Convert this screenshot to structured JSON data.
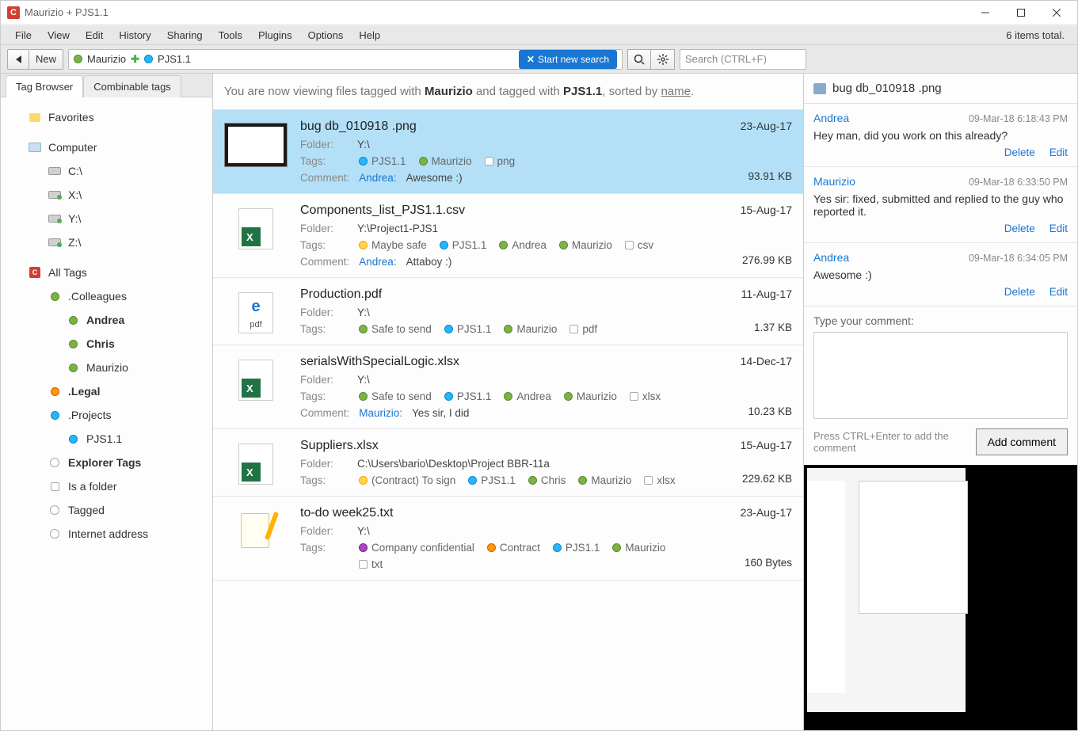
{
  "title": "Maurizio  +  PJS1.1",
  "menu": [
    "File",
    "View",
    "Edit",
    "History",
    "Sharing",
    "Tools",
    "Plugins",
    "Options",
    "Help"
  ],
  "items_total": "6 items total.",
  "toolbar": {
    "new_label": "New",
    "path_tag1": "Maurizio",
    "path_tag2": "PJS1.1",
    "start_search": "Start new search",
    "search_placeholder": "Search (CTRL+F)"
  },
  "left": {
    "tab1": "Tag Browser",
    "tab2": "Combinable tags",
    "favorites": "Favorites",
    "computer": "Computer",
    "drives": [
      "C:\\",
      "X:\\",
      "Y:\\",
      "Z:\\"
    ],
    "alltags": "All Tags",
    "colleagues": ".Colleagues",
    "andrea": "Andrea",
    "chris": "Chris",
    "maurizio": "Maurizio",
    "legal": ".Legal",
    "projects": ".Projects",
    "pjs11": "PJS1.1",
    "explorer_tags": "Explorer Tags",
    "is_folder": "Is a folder",
    "tagged": "Tagged",
    "internet": "Internet address"
  },
  "filter_desc": {
    "prefix": "You are now viewing files tagged with ",
    "tag1": "Maurizio",
    "mid": "  and   tagged with ",
    "tag2": "PJS1.1",
    "suffix": ", sorted by ",
    "sort": "name",
    "end": "."
  },
  "tag_labels": {
    "pjs11": "PJS1.1",
    "maurizio": "Maurizio",
    "png": "png",
    "maybe_safe": "Maybe safe",
    "andrea": "Andrea",
    "csv": "csv",
    "safe_send": "Safe to send",
    "pdf": "pdf",
    "xlsx": "xlsx",
    "contract_sign": "(Contract) To sign",
    "chris": "Chris",
    "confidential": "Company confidential",
    "contract": "Contract",
    "txt": "txt"
  },
  "labels": {
    "folder": "Folder:",
    "tags": "Tags:",
    "comment": "Comment:"
  },
  "files": [
    {
      "name": "bug db_010918 .png",
      "date": "23-Aug-17",
      "folder": "Y:\\",
      "size": "93.91 KB",
      "comment_author": "Andrea:",
      "comment_text": "Awesome :)"
    },
    {
      "name": "Components_list_PJS1.1.csv",
      "date": "15-Aug-17",
      "folder": "Y:\\Project1-PJS1",
      "size": "276.99 KB",
      "comment_author": "Andrea:",
      "comment_text": "Attaboy :)"
    },
    {
      "name": "Production.pdf",
      "date": "11-Aug-17",
      "folder": "Y:\\",
      "size": "1.37 KB"
    },
    {
      "name": "serialsWithSpecialLogic.xlsx",
      "date": "14-Dec-17",
      "folder": "Y:\\",
      "size": "10.23 KB",
      "comment_author": "Maurizio:",
      "comment_text": "Yes sir, I did"
    },
    {
      "name": "Suppliers.xlsx",
      "date": "15-Aug-17",
      "folder": "C:\\Users\\bario\\Desktop\\Project BBR-11a",
      "size": "229.62 KB"
    },
    {
      "name": "to-do week25.txt",
      "date": "23-Aug-17",
      "folder": "Y:\\",
      "size": "160 Bytes"
    }
  ],
  "right": {
    "header": "bug db_010918 .png",
    "comments": [
      {
        "author": "Andrea",
        "ts": "09-Mar-18 6:18:43 PM",
        "body": "Hey man, did you work on this already?"
      },
      {
        "author": "Maurizio",
        "ts": "09-Mar-18 6:33:50 PM",
        "body": "Yes sir: fixed, submitted and replied to the guy who reported it."
      },
      {
        "author": "Andrea",
        "ts": "09-Mar-18 6:34:05 PM",
        "body": "Awesome :)"
      }
    ],
    "delete": "Delete",
    "edit": "Edit",
    "type_label": "Type your comment:",
    "hint": "Press CTRL+Enter to add the comment",
    "add_btn": "Add comment"
  }
}
